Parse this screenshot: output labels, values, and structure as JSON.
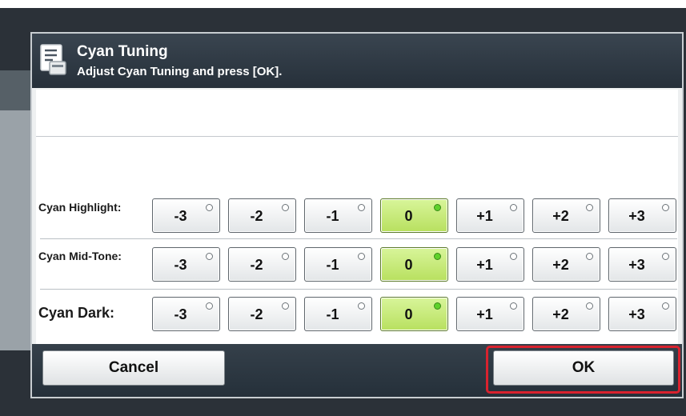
{
  "dialog": {
    "title": "Cyan Tuning",
    "subtitle": "Adjust Cyan Tuning and press [OK].",
    "icon": "document-settings-icon"
  },
  "rows": [
    {
      "label": "Cyan Highlight:",
      "selected": "0"
    },
    {
      "label": "Cyan Mid-Tone:",
      "selected": "0"
    },
    {
      "label": "Cyan Dark:",
      "selected": "0"
    }
  ],
  "options": [
    "-3",
    "-2",
    "-1",
    "0",
    "+1",
    "+2",
    "+3"
  ],
  "buttons": {
    "cancel": "Cancel",
    "ok": "OK"
  },
  "colors": {
    "selected_option": "#c6ea79",
    "selected_radio": "#5fd12b",
    "highlight_border": "#d9222e",
    "title_bar": "#2f3a44"
  }
}
